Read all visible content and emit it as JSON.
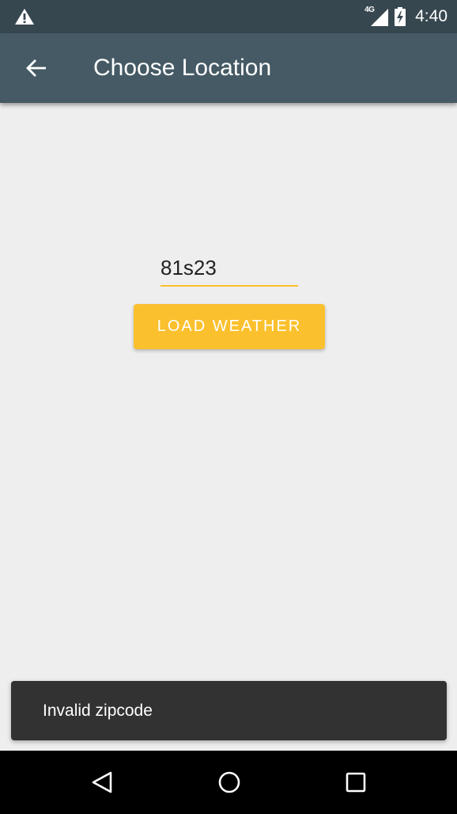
{
  "status_bar": {
    "network_label": "4G",
    "time": "4:40",
    "warning_icon": "warning-icon",
    "signal_icon": "signal-icon",
    "battery_icon": "battery-charging-icon"
  },
  "app_bar": {
    "title": "Choose Location",
    "back_icon": "arrow-back-icon"
  },
  "form": {
    "zip_value": "81s23",
    "load_button_label": "LOAD WEATHER",
    "accent_color": "#fbc02d"
  },
  "snackbar": {
    "message": "Invalid zipcode"
  },
  "nav_bar": {
    "back_icon": "nav-back-icon",
    "home_icon": "nav-home-icon",
    "recents_icon": "nav-recents-icon"
  },
  "colors": {
    "status_bar": "#37474f",
    "app_bar": "#455a64",
    "background": "#eeeeee",
    "snackbar": "#323232"
  }
}
